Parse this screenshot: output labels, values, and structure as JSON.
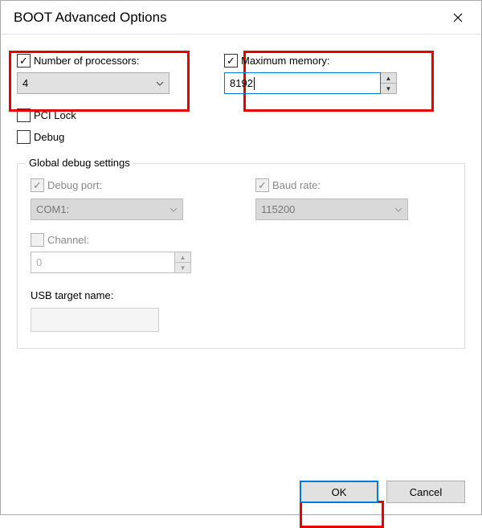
{
  "title": "BOOT Advanced Options",
  "numProcessors": {
    "label": "Number of processors:",
    "checked": true,
    "value": "4"
  },
  "maxMemory": {
    "label": "Maximum memory:",
    "checked": true,
    "value": "8192"
  },
  "pciLock": {
    "label": "PCI Lock",
    "checked": false
  },
  "debug": {
    "label": "Debug",
    "checked": false
  },
  "globalDebug": {
    "legend": "Global debug settings",
    "debugPort": {
      "label": "Debug port:",
      "checked": true,
      "value": "COM1:"
    },
    "baudRate": {
      "label": "Baud rate:",
      "checked": true,
      "value": "115200"
    },
    "channel": {
      "label": "Channel:",
      "checked": false,
      "value": "0"
    },
    "usb": {
      "label": "USB target name:",
      "value": ""
    }
  },
  "buttons": {
    "ok": "OK",
    "cancel": "Cancel"
  }
}
